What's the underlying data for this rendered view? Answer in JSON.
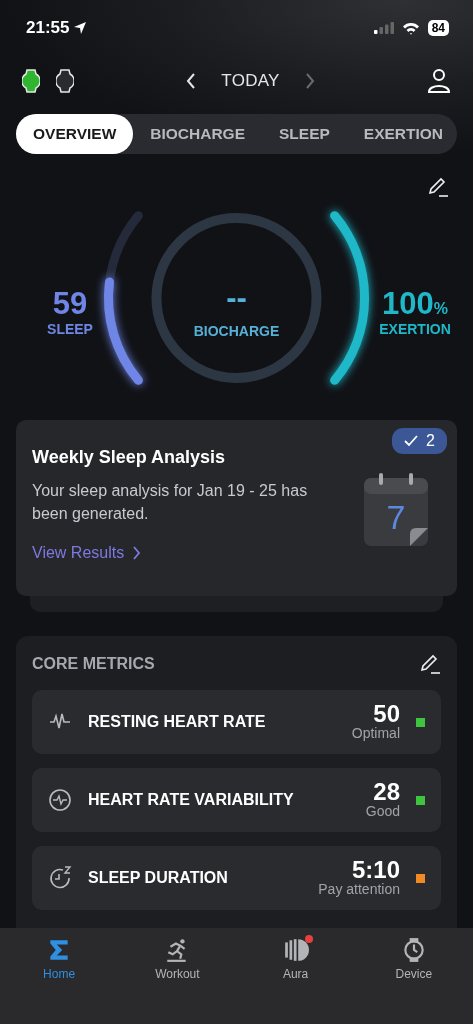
{
  "status_bar": {
    "time": "21:55",
    "battery": "84"
  },
  "header": {
    "devices": [
      {
        "connected": true
      },
      {
        "connected": false
      }
    ],
    "date_label": "TODAY",
    "prev_disabled": false,
    "next_disabled": true
  },
  "tabs": [
    {
      "label": "OVERVIEW",
      "selected": true
    },
    {
      "label": "BIOCHARGE",
      "selected": false
    },
    {
      "label": "SLEEP",
      "selected": false
    },
    {
      "label": "EXERTION",
      "selected": false
    }
  ],
  "gauges": {
    "sleep": {
      "value": "59",
      "label": "SLEEP"
    },
    "biocharge": {
      "value": "--",
      "label": "BIOCHARGE"
    },
    "exertion": {
      "value": "100",
      "unit": "%",
      "label": "EXERTION"
    }
  },
  "insight_card": {
    "title": "Weekly Sleep Analysis",
    "body": "Your sleep analysis for Jan 19 - 25 has been generated.",
    "link": "View Results",
    "badge_count": "2",
    "calendar_day": "7"
  },
  "core_metrics": {
    "title": "CORE METRICS",
    "items": [
      {
        "kind": "pulse",
        "name": "RESTING HEART RATE",
        "value": "50",
        "status": "Optimal",
        "color": "#3ec43e"
      },
      {
        "kind": "hrv",
        "name": "HEART RATE VARIABILITY",
        "value": "28",
        "status": "Good",
        "color": "#3ec43e"
      },
      {
        "kind": "sleep",
        "name": "SLEEP DURATION",
        "value": "5:10",
        "status": "Pay attention",
        "color": "#f08a24"
      }
    ]
  },
  "bottom_nav": [
    {
      "kind": "home",
      "label": "Home",
      "selected": true,
      "alert": false
    },
    {
      "kind": "workout",
      "label": "Workout",
      "selected": false,
      "alert": false
    },
    {
      "kind": "aura",
      "label": "Aura",
      "selected": false,
      "alert": true
    },
    {
      "kind": "device",
      "label": "Device",
      "selected": false,
      "alert": false
    }
  ]
}
